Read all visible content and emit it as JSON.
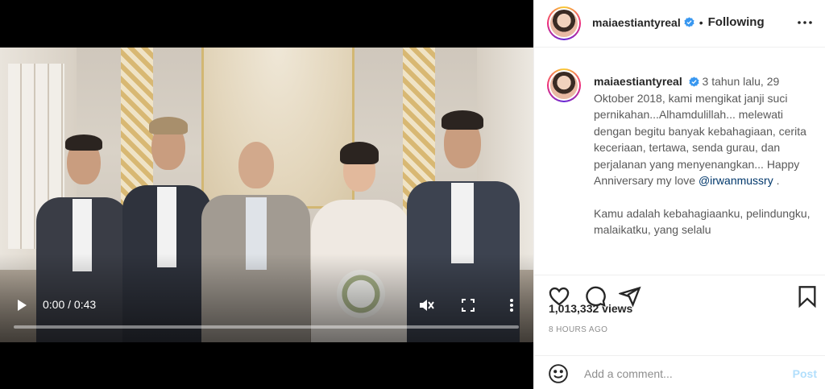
{
  "video": {
    "time_label": "0:00 / 0:43",
    "progress": 0,
    "icons": {
      "play": "play-icon",
      "mute": "muted-speaker-icon",
      "fullscreen": "fullscreen-icon",
      "more": "more-vertical-icon"
    }
  },
  "header": {
    "username": "maiaestiantyreal",
    "separator": "•",
    "follow_status": "Following",
    "verified_icon": "verified-badge-icon",
    "more_icon": "more-horizontal-icon"
  },
  "caption": {
    "username": "maiaestiantyreal",
    "text_line1": "3 tahun lalu, 29 Oktober 2018, kami mengikat janji suci pernikahan...Alhamdulillah... melewati dengan begitu banyak kebahagiaan, cerita keceriaan, tertawa, senda gurau, dan perjalanan yang menyenangkan... Happy Anniversary my love",
    "mention": "@irwanmussry",
    "mention_suffix": " .",
    "paragraph2": "Kamu adalah kebahagiaanku, pelindungku, malaikatku, yang selalu"
  },
  "actions": {
    "icons": [
      "heart-icon",
      "comment-icon",
      "share-icon",
      "bookmark-icon"
    ],
    "views": "1,013,332 views",
    "time_ago": "8 HOURS AGO"
  },
  "comment": {
    "placeholder": "Add a comment...",
    "post_label": "Post",
    "emoji_icon": "emoji-icon"
  },
  "colors": {
    "verified": "#3897f0",
    "post_disabled": "#b2dffc",
    "mention": "#00376b",
    "meta": "#8e8e8e"
  }
}
